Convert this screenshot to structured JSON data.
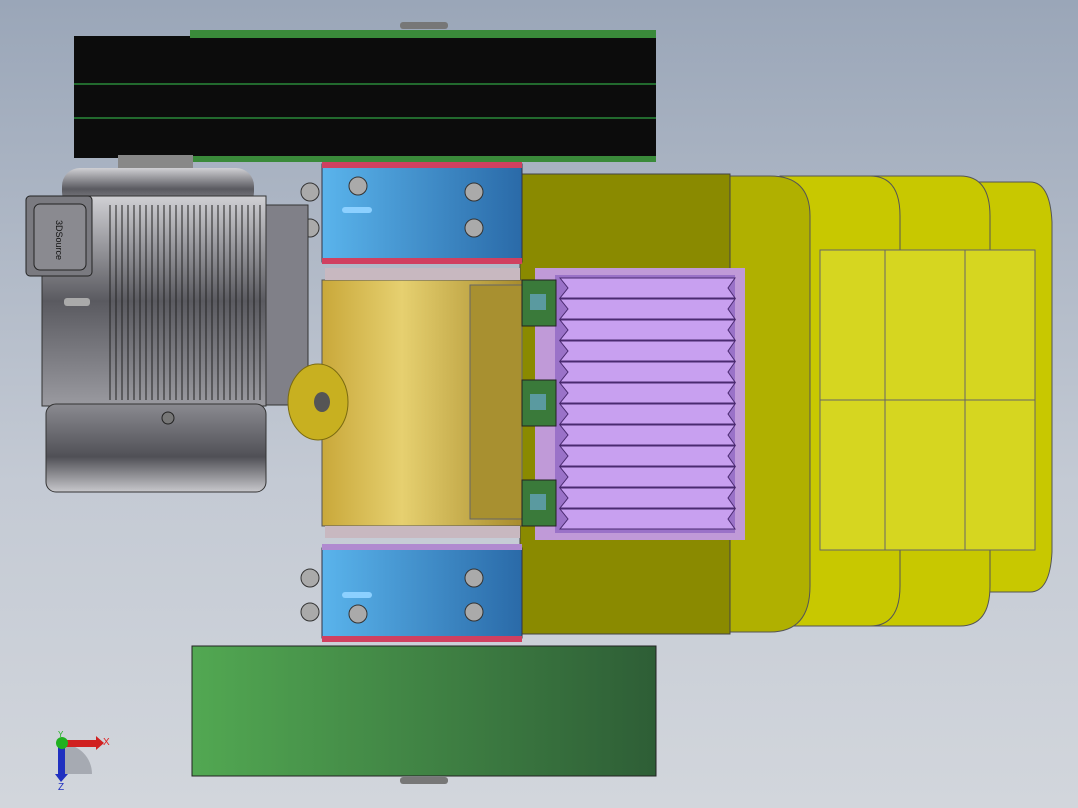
{
  "viewport": {
    "type": "3D CAD model view"
  },
  "motor": {
    "nameplate_text": "3DSource"
  },
  "triad": {
    "x_label": "X",
    "y_label": "Y",
    "z_label": "Z"
  },
  "colors": {
    "belt": "#0a0a0a",
    "pulley_green": "#4a9a4a",
    "bearing_blue": "#3a8ccc",
    "frame_olive": "#8a8a00",
    "hopper_yellow": "#c8c800",
    "roller_gold": "#d4b84a",
    "teeth_purple": "#b78ae0",
    "motor_grey": "#6a6a6e"
  }
}
